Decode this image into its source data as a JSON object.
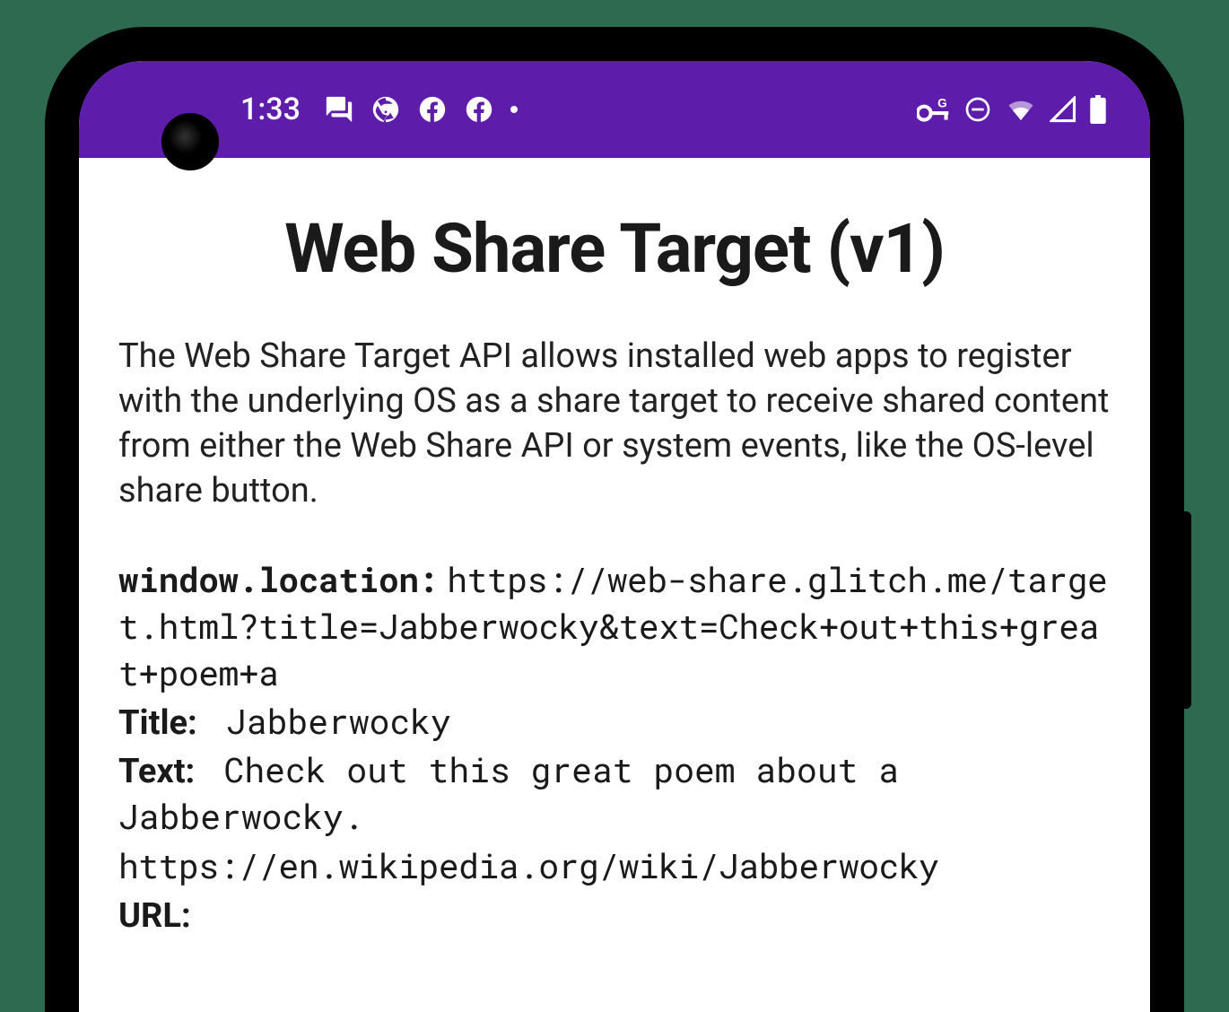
{
  "status_bar": {
    "time": "1:33",
    "accent_color": "#5e1caa"
  },
  "page": {
    "title": "Web Share Target (v1)",
    "description": "The Web Share Target API allows installed web apps to register with the underlying OS as a share target to receive shared content from either the Web Share API or system events, like the OS-level share button."
  },
  "shared_data": {
    "location_label": "window.location:",
    "location_value": "https://web-share.glitch.me/target.html?title=Jabberwocky&text=Check+out+this+great+poem+a",
    "title_label": "Title:",
    "title_value": "Jabberwocky",
    "text_label": "Text:",
    "text_value": "Check out this great poem about a Jabberwocky.",
    "text_url": "https://en.wikipedia.org/wiki/Jabberwocky",
    "url_label": "URL:",
    "url_value": ""
  }
}
